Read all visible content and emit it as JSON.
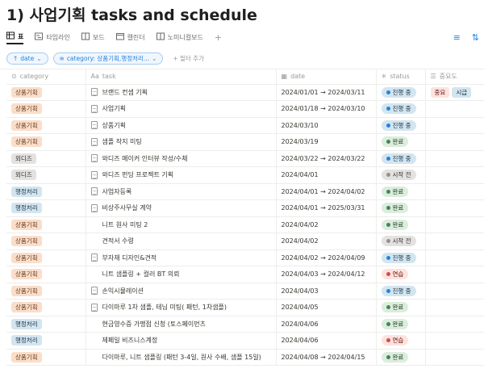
{
  "page": {
    "title": "1) 사업기획 tasks and schedule"
  },
  "views": [
    {
      "label": "표",
      "icon": "table-icon",
      "active": true
    },
    {
      "label": "타임라인",
      "icon": "timeline-icon",
      "active": false
    },
    {
      "label": "보드",
      "icon": "board-icon",
      "active": false
    },
    {
      "label": "캘린더",
      "icon": "calendar-icon",
      "active": false
    },
    {
      "label": "노미니컬보드",
      "icon": "board-icon",
      "active": false
    }
  ],
  "filters": {
    "sort_chip": "date",
    "category_chip": "category: 상품기획,행정처리...",
    "add_filter": "필터 추가"
  },
  "table": {
    "headers": {
      "category": "category",
      "task": "task",
      "date": "date",
      "status": "status",
      "importance": "중요도"
    },
    "header_icons": {
      "category": "select-icon",
      "task": "Aa",
      "date": "calendar-icon",
      "status": "status-icon",
      "importance": "multiselect-icon"
    },
    "rows": [
      {
        "category": "상품기획",
        "task": "브랜드 컨셉 기획",
        "doc": true,
        "date": "2024/01/01 → 2024/03/11",
        "status": "진행 중",
        "importance": [
          "중요",
          "시급"
        ]
      },
      {
        "category": "상품기획",
        "task": "사업기획",
        "doc": true,
        "date": "2024/01/18 → 2024/03/10",
        "status": "진행 중",
        "importance": []
      },
      {
        "category": "상품기획",
        "task": "상품기획",
        "doc": true,
        "date": "2024/03/10",
        "status": "진행 중",
        "importance": []
      },
      {
        "category": "상품기획",
        "task": "샘플 작지 미팅",
        "doc": true,
        "date": "2024/03/19",
        "status": "완료",
        "importance": []
      },
      {
        "category": "외디즈",
        "task": "와디즈 메이커 인터뷰 작성/수체",
        "doc": true,
        "date": "2024/03/22 → 2024/03/22",
        "status": "진행 중",
        "importance": []
      },
      {
        "category": "외디즈",
        "task": "와디즈 펀딩 프로젝트 기획",
        "doc": true,
        "date": "2024/04/01",
        "status": "시작 전",
        "importance": []
      },
      {
        "category": "행정처리",
        "task": "사업자등록",
        "doc": true,
        "date": "2024/04/01 → 2024/04/02",
        "status": "완료",
        "importance": []
      },
      {
        "category": "행정처리",
        "task": "비상주사무실 계약",
        "doc": true,
        "date": "2024/04/01 → 2025/03/31",
        "status": "완료",
        "importance": []
      },
      {
        "category": "상품기획",
        "task": "니트 원사 미팅 2",
        "doc": false,
        "date": "2024/04/02",
        "status": "완료",
        "importance": []
      },
      {
        "category": "상품기획",
        "task": "견적서 수령",
        "doc": false,
        "date": "2024/04/02",
        "status": "시작 전",
        "importance": []
      },
      {
        "category": "상품기획",
        "task": "부자재 디자인&견적",
        "doc": true,
        "date": "2024/04/02 → 2024/04/09",
        "status": "진행 중",
        "importance": []
      },
      {
        "category": "상품기획",
        "task": "니트 샘플링 + 컬러 BT 의뢰",
        "doc": false,
        "date": "2024/04/03 → 2024/04/12",
        "status": "연습",
        "importance": []
      },
      {
        "category": "상품기획",
        "task": "손익시뮬레이션",
        "doc": true,
        "date": "2024/04/03",
        "status": "진행 중",
        "importance": []
      },
      {
        "category": "상품기획",
        "task": "다이마루 1차 샘플, 테님 미팅( 패턴, 1차샘플)",
        "doc": true,
        "date": "2024/04/05",
        "status": "완료",
        "importance": []
      },
      {
        "category": "행정처리",
        "task": "현금영수증 가맹점 신청 (토스페이먼츠",
        "doc": false,
        "date": "2024/04/06",
        "status": "완료",
        "importance": []
      },
      {
        "category": "행정처리",
        "task": "제페일 비즈니스계정",
        "doc": false,
        "date": "2024/04/06",
        "status": "연습",
        "importance": []
      },
      {
        "category": "상품기획",
        "task": "다이마루, 니트 샘플링 (패턴 3-4일, 원사 수배, 샘플 15일)",
        "doc": false,
        "date": "2024/04/08 → 2024/04/15",
        "status": "완료",
        "importance": []
      }
    ]
  },
  "colors": {
    "accent": "#2383e2",
    "status": {
      "진행 중": {
        "bg": "#d3e5ef",
        "fg": "#183347",
        "dot": "#2383e2"
      },
      "완료": {
        "bg": "#dbeddb",
        "fg": "#1c3829",
        "dot": "#448361"
      },
      "시작 전": {
        "bg": "#e3e2e0",
        "fg": "#32302c",
        "dot": "#91918e"
      },
      "연습": {
        "bg": "#ffe2dd",
        "fg": "#5d1715",
        "dot": "#d44c47"
      }
    },
    "categories": {
      "상품기획": "cat-plan",
      "행정처리": "cat-admin",
      "외디즈": "cat-out"
    },
    "importance": {
      "중요": "imp-red",
      "시급": "imp-blue"
    }
  }
}
